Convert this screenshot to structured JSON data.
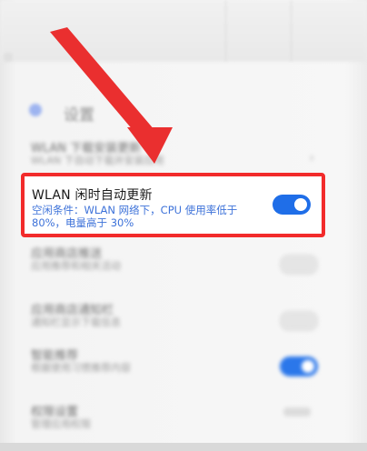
{
  "header": {
    "title": "设置"
  },
  "rows": [
    {
      "title": "WLAN 下载安装更新",
      "subtitle": "WLAN 下自动下载并安装应用",
      "control": "chevron"
    },
    {
      "title": "WLAN 闲时自动更新",
      "subtitle": "空闲条件：WLAN 网络下，CPU 使用率低于80%，电量高于 30%",
      "control": "toggle",
      "enabled": true
    },
    {
      "title": "应用商店推送",
      "subtitle": "应用推荐和相关活动",
      "control": "toggle",
      "enabled": false
    },
    {
      "title": "应用商店通知栏",
      "subtitle": "通知栏显示下载信息",
      "control": "toggle",
      "enabled": false
    },
    {
      "title": "智能推荐",
      "subtitle": "根据使用习惯推荐内容",
      "control": "toggle",
      "enabled": true
    },
    {
      "title": "权限设置",
      "subtitle": "管理应用权限",
      "control": "pill"
    }
  ],
  "highlighted": {
    "title": "WLAN 闲时自动更新",
    "description": "空闲条件：WLAN 网络下，CPU 使用率低于80%，电量高于 30%",
    "toggle_on": true
  },
  "colors": {
    "highlight_border": "#f22b2b",
    "accent_blue": "#1f6ee8",
    "arrow_red": "#ea2f2f"
  },
  "icons": {
    "back": "back-icon",
    "chevron": "chevron-right-icon"
  }
}
